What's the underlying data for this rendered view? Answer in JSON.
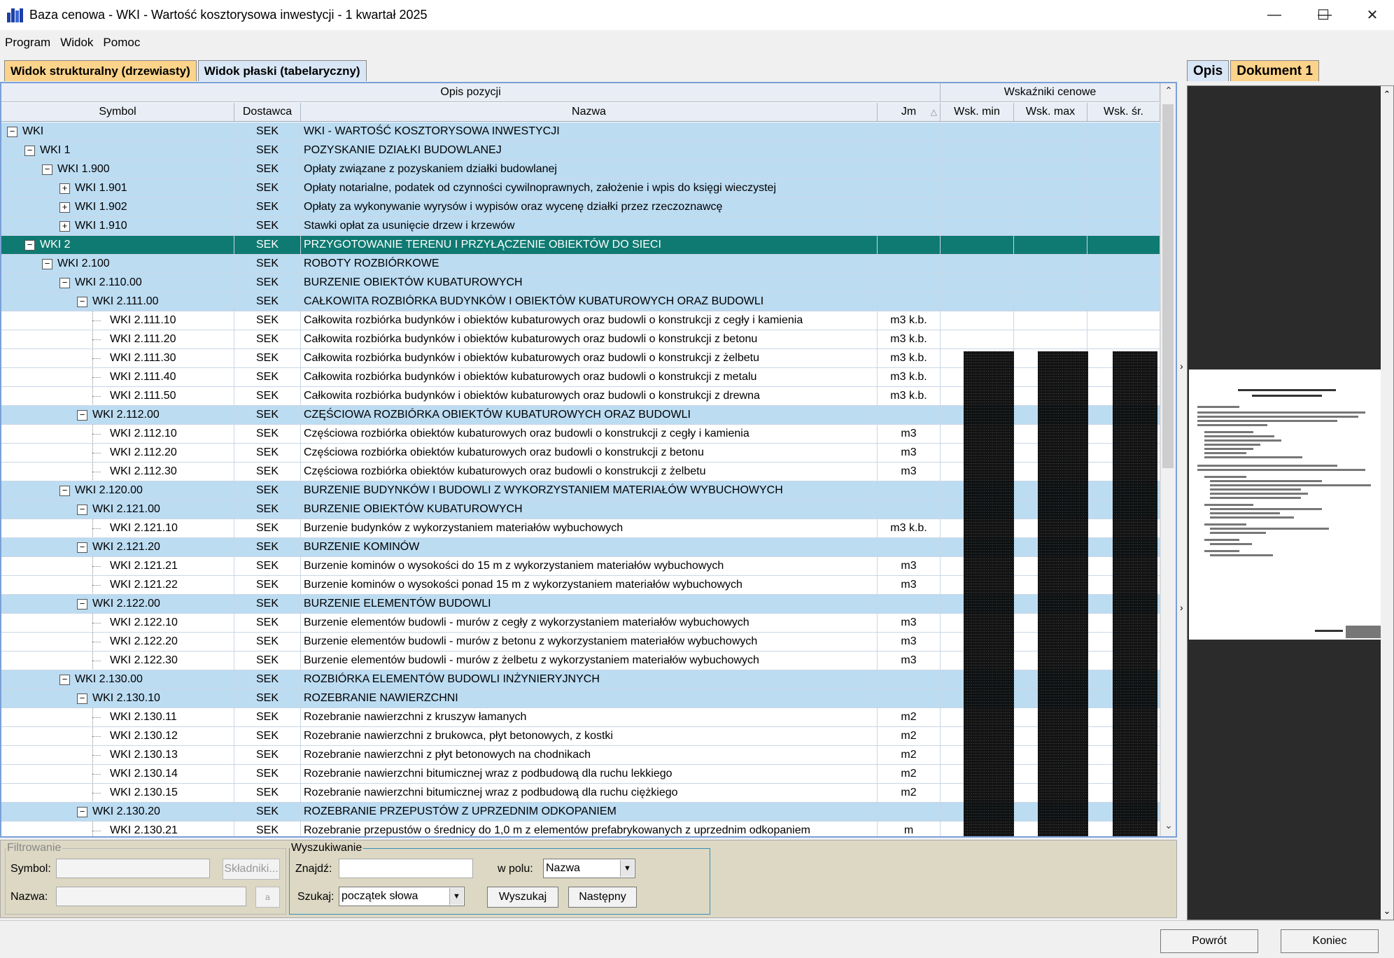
{
  "window": {
    "title": "Baza cenowa - WKI - Wartość kosztorysowa inwestycji - 1 kwartał 2025",
    "minimize": "—",
    "maximize": "☐",
    "close": "✕"
  },
  "menu": [
    "Program",
    "Widok",
    "Pomoc"
  ],
  "tabs": {
    "structural": "Widok strukturalny (drzewiasty)",
    "flat": "Widok płaski (tabelaryczny)"
  },
  "grid": {
    "group_headers": {
      "opis": "Opis pozycji",
      "wsk": "Wskaźniki cenowe"
    },
    "columns": {
      "symbol": "Symbol",
      "dostawca": "Dostawca",
      "nazwa": "Nazwa",
      "jm": "Jm",
      "sort_icon": "△",
      "wsk_min": "Wsk. min",
      "wsk_max": "Wsk. max",
      "wsk_sr": "Wsk. śr."
    },
    "rows": [
      {
        "level": 0,
        "tog": "−",
        "symbol": "WKI",
        "dostawca": "SEK",
        "nazwa": "WKI - WARTOŚĆ KOSZTORYSOWA INWESTYCJI",
        "jm": "",
        "type": "grp"
      },
      {
        "level": 1,
        "tog": "−",
        "symbol": "WKI 1",
        "dostawca": "SEK",
        "nazwa": "POZYSKANIE DZIAŁKI BUDOWLANEJ",
        "jm": "",
        "type": "grp"
      },
      {
        "level": 2,
        "tog": "−",
        "symbol": "WKI 1.900",
        "dostawca": "SEK",
        "nazwa": "Opłaty związane z pozyskaniem działki budowlanej",
        "jm": "",
        "type": "grp"
      },
      {
        "level": 3,
        "tog": "+",
        "symbol": "WKI 1.901",
        "dostawca": "SEK",
        "nazwa": "Opłaty notarialne, podatek od czynności cywilnoprawnych, założenie i wpis do księgi wieczystej",
        "jm": "",
        "type": "grp"
      },
      {
        "level": 3,
        "tog": "+",
        "symbol": "WKI 1.902",
        "dostawca": "SEK",
        "nazwa": "Opłaty za wykonywanie wyrysów i wypisów oraz wycenę działki przez rzeczoznawcę",
        "jm": "",
        "type": "grp"
      },
      {
        "level": 3,
        "tog": "+",
        "symbol": "WKI 1.910",
        "dostawca": "SEK",
        "nazwa": "Stawki opłat za usunięcie drzew i krzewów",
        "jm": "",
        "type": "grp"
      },
      {
        "level": 1,
        "tog": "−",
        "symbol": "WKI 2",
        "dostawca": "SEK",
        "nazwa": "PRZYGOTOWANIE TERENU I PRZYŁĄCZENIE OBIEKTÓW DO SIECI",
        "jm": "",
        "type": "sel"
      },
      {
        "level": 2,
        "tog": "−",
        "symbol": "WKI 2.100",
        "dostawca": "SEK",
        "nazwa": "ROBOTY ROZBIÓRKOWE",
        "jm": "",
        "type": "grp"
      },
      {
        "level": 3,
        "tog": "−",
        "symbol": "WKI 2.110.00",
        "dostawca": "SEK",
        "nazwa": "BURZENIE OBIEKTÓW KUBATUROWYCH",
        "jm": "",
        "type": "grp"
      },
      {
        "level": 4,
        "tog": "−",
        "symbol": "WKI 2.111.00",
        "dostawca": "SEK",
        "nazwa": "CAŁKOWITA ROZBIÓRKA BUDYNKÓW I OBIEKTÓW KUBATUROWYCH ORAZ BUDOWLI",
        "jm": "",
        "type": "grp"
      },
      {
        "level": 5,
        "tog": "",
        "symbol": "WKI 2.111.10",
        "dostawca": "SEK",
        "nazwa": "Całkowita rozbiórka budynków i obiektów kubaturowych oraz budowli o konstrukcji z cegły i kamienia",
        "jm": "m3 k.b.",
        "type": "leaf"
      },
      {
        "level": 5,
        "tog": "",
        "symbol": "WKI 2.111.20",
        "dostawca": "SEK",
        "nazwa": "Całkowita rozbiórka budynków i obiektów kubaturowych oraz budowli o konstrukcji z betonu",
        "jm": "m3 k.b.",
        "type": "leaf"
      },
      {
        "level": 5,
        "tog": "",
        "symbol": "WKI 2.111.30",
        "dostawca": "SEK",
        "nazwa": "Całkowita rozbiórka budynków i obiektów kubaturowych oraz budowli o konstrukcji z żelbetu",
        "jm": "m3 k.b.",
        "type": "leaf"
      },
      {
        "level": 5,
        "tog": "",
        "symbol": "WKI 2.111.40",
        "dostawca": "SEK",
        "nazwa": "Całkowita rozbiórka budynków i obiektów kubaturowych oraz budowli o konstrukcji z metalu",
        "jm": "m3 k.b.",
        "type": "leaf"
      },
      {
        "level": 5,
        "tog": "",
        "symbol": "WKI 2.111.50",
        "dostawca": "SEK",
        "nazwa": "Całkowita rozbiórka budynków i obiektów kubaturowych oraz budowli o konstrukcji z drewna",
        "jm": "m3 k.b.",
        "type": "leaf"
      },
      {
        "level": 4,
        "tog": "−",
        "symbol": "WKI 2.112.00",
        "dostawca": "SEK",
        "nazwa": "CZĘŚCIOWA ROZBIÓRKA OBIEKTÓW KUBATUROWYCH ORAZ BUDOWLI",
        "jm": "",
        "type": "grp"
      },
      {
        "level": 5,
        "tog": "",
        "symbol": "WKI 2.112.10",
        "dostawca": "SEK",
        "nazwa": "Częściowa rozbiórka obiektów kubaturowych oraz budowli o konstrukcji z cegły i kamienia",
        "jm": "m3",
        "type": "leaf"
      },
      {
        "level": 5,
        "tog": "",
        "symbol": "WKI 2.112.20",
        "dostawca": "SEK",
        "nazwa": "Częściowa rozbiórka obiektów kubaturowych oraz budowli o konstrukcji z betonu",
        "jm": "m3",
        "type": "leaf"
      },
      {
        "level": 5,
        "tog": "",
        "symbol": "WKI 2.112.30",
        "dostawca": "SEK",
        "nazwa": "Częściowa rozbiórka obiektów kubaturowych oraz budowli o konstrukcji z żelbetu",
        "jm": "m3",
        "type": "leaf"
      },
      {
        "level": 3,
        "tog": "−",
        "symbol": "WKI 2.120.00",
        "dostawca": "SEK",
        "nazwa": "BURZENIE BUDYNKÓW I BUDOWLI Z WYKORZYSTANIEM MATERIAŁÓW WYBUCHOWYCH",
        "jm": "",
        "type": "grp"
      },
      {
        "level": 4,
        "tog": "−",
        "symbol": "WKI 2.121.00",
        "dostawca": "SEK",
        "nazwa": "BURZENIE OBIEKTÓW KUBATUROWYCH",
        "jm": "",
        "type": "grp"
      },
      {
        "level": 5,
        "tog": "",
        "symbol": "WKI 2.121.10",
        "dostawca": "SEK",
        "nazwa": "Burzenie budynków z wykorzystaniem materiałów wybuchowych",
        "jm": "m3 k.b.",
        "type": "leaf"
      },
      {
        "level": 4,
        "tog": "−",
        "symbol": "WKI 2.121.20",
        "dostawca": "SEK",
        "nazwa": "BURZENIE KOMINÓW",
        "jm": "",
        "type": "grp"
      },
      {
        "level": 5,
        "tog": "",
        "symbol": "WKI 2.121.21",
        "dostawca": "SEK",
        "nazwa": "Burzenie kominów o wysokości do 15 m z wykorzystaniem materiałów wybuchowych",
        "jm": "m3",
        "type": "leaf"
      },
      {
        "level": 5,
        "tog": "",
        "symbol": "WKI 2.121.22",
        "dostawca": "SEK",
        "nazwa": "Burzenie kominów o wysokości ponad 15 m z wykorzystaniem materiałów wybuchowych",
        "jm": "m3",
        "type": "leaf"
      },
      {
        "level": 4,
        "tog": "−",
        "symbol": "WKI 2.122.00",
        "dostawca": "SEK",
        "nazwa": "BURZENIE ELEMENTÓW BUDOWLI",
        "jm": "",
        "type": "grp"
      },
      {
        "level": 5,
        "tog": "",
        "symbol": "WKI 2.122.10",
        "dostawca": "SEK",
        "nazwa": "Burzenie elementów budowli - murów z cegły z wykorzystaniem materiałów wybuchowych",
        "jm": "m3",
        "type": "leaf"
      },
      {
        "level": 5,
        "tog": "",
        "symbol": "WKI 2.122.20",
        "dostawca": "SEK",
        "nazwa": "Burzenie elementów budowli - murów z betonu z wykorzystaniem materiałów wybuchowych",
        "jm": "m3",
        "type": "leaf"
      },
      {
        "level": 5,
        "tog": "",
        "symbol": "WKI 2.122.30",
        "dostawca": "SEK",
        "nazwa": "Burzenie elementów budowli - murów z żelbetu z wykorzystaniem materiałów wybuchowych",
        "jm": "m3",
        "type": "leaf"
      },
      {
        "level": 3,
        "tog": "−",
        "symbol": "WKI 2.130.00",
        "dostawca": "SEK",
        "nazwa": "ROZBIÓRKA ELEMENTÓW BUDOWLI INŻYNIERYJNYCH",
        "jm": "",
        "type": "grp"
      },
      {
        "level": 4,
        "tog": "−",
        "symbol": "WKI 2.130.10",
        "dostawca": "SEK",
        "nazwa": "ROZEBRANIE NAWIERZCHNI",
        "jm": "",
        "type": "grp"
      },
      {
        "level": 5,
        "tog": "",
        "symbol": "WKI 2.130.11",
        "dostawca": "SEK",
        "nazwa": "Rozebranie nawierzchni z kruszyw łamanych",
        "jm": "m2",
        "type": "leaf"
      },
      {
        "level": 5,
        "tog": "",
        "symbol": "WKI 2.130.12",
        "dostawca": "SEK",
        "nazwa": "Rozebranie nawierzchni z brukowca, płyt betonowych, z kostki",
        "jm": "m2",
        "type": "leaf"
      },
      {
        "level": 5,
        "tog": "",
        "symbol": "WKI 2.130.13",
        "dostawca": "SEK",
        "nazwa": "Rozebranie nawierzchni z płyt betonowych na chodnikach",
        "jm": "m2",
        "type": "leaf"
      },
      {
        "level": 5,
        "tog": "",
        "symbol": "WKI 2.130.14",
        "dostawca": "SEK",
        "nazwa": "Rozebranie nawierzchni bitumicznej wraz z podbudową dla ruchu lekkiego",
        "jm": "m2",
        "type": "leaf"
      },
      {
        "level": 5,
        "tog": "",
        "symbol": "WKI 2.130.15",
        "dostawca": "SEK",
        "nazwa": "Rozebranie nawierzchni bitumicznej wraz z podbudową dla ruchu ciężkiego",
        "jm": "m2",
        "type": "leaf"
      },
      {
        "level": 4,
        "tog": "−",
        "symbol": "WKI 2.130.20",
        "dostawca": "SEK",
        "nazwa": "ROZEBRANIE PRZEPUSTÓW Z UPRZEDNIM ODKOPANIEM",
        "jm": "",
        "type": "grp"
      },
      {
        "level": 5,
        "tog": "",
        "symbol": "WKI 2.130.21",
        "dostawca": "SEK",
        "nazwa": "Rozebranie przepustów o średnicy do 1,0 m z elementów prefabrykowanych z uprzednim odkopaniem",
        "jm": "m",
        "type": "leaf"
      }
    ]
  },
  "filter": {
    "legend": "Filtrowanie",
    "symbol_label": "Symbol:",
    "symbol_value": "",
    "nazwa_label": "Nazwa:",
    "nazwa_value": "",
    "skladniki": "Składniki...",
    "small_btn": "a"
  },
  "search": {
    "legend": "Wyszukiwanie",
    "znajdz_label": "Znajdź:",
    "znajdz_value": "",
    "wpolu_label": "w polu:",
    "wpolu_value": "Nazwa",
    "szukaj_label": "Szukaj:",
    "szukaj_value": "początek słowa",
    "wyszukaj": "Wyszukaj",
    "nastepny": "Następny"
  },
  "right": {
    "tab_opis": "Opis",
    "tab_dok": "Dokument 1"
  },
  "status": {
    "powrot": "Powrót",
    "koniec": "Koniec"
  },
  "colors": {
    "accent": "#fbd38a",
    "selected": "#0f7a72",
    "group": "#bcdcf2"
  }
}
